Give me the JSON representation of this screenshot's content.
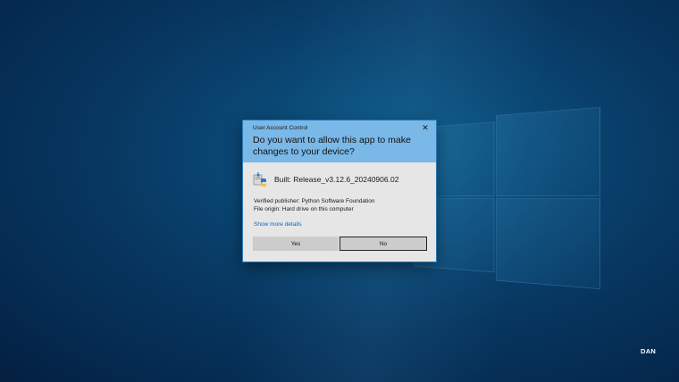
{
  "dialog": {
    "window_title": "User Account Control",
    "close_label": "✕",
    "question": "Do you want to allow this app to make changes to your device?",
    "app_name": "Built: Release_v3.12.6_20240906.02",
    "app_icon": "python-installer-icon",
    "publisher": "Verified publisher: Python Software Foundation",
    "file_origin": "File origin: Hard drive on this computer",
    "more_details": "Show more details",
    "yes_label": "Yes",
    "no_label": "No",
    "header_color": "#7ab8e8",
    "body_color": "#e6e6e6",
    "link_color": "#0b67c2"
  },
  "watermark": {
    "text": "DAN"
  }
}
